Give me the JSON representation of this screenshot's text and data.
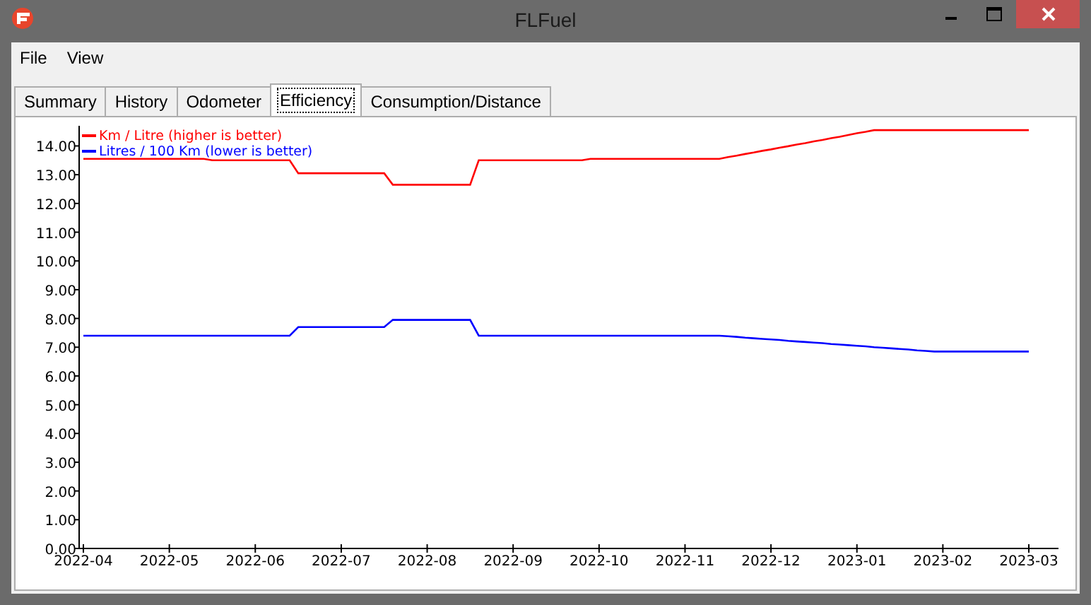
{
  "window": {
    "title": "FLFuel"
  },
  "menu": [
    {
      "label": "File"
    },
    {
      "label": "View"
    }
  ],
  "tabs": [
    {
      "label": "Summary",
      "selected": false
    },
    {
      "label": "History",
      "selected": false
    },
    {
      "label": "Odometer",
      "selected": false
    },
    {
      "label": "Efficiency",
      "selected": true
    },
    {
      "label": "Consumption/Distance",
      "selected": false
    }
  ],
  "chart": {
    "chart_data": {
      "type": "line",
      "categories": [
        "2022-04",
        null,
        null,
        null,
        null,
        null,
        null,
        null,
        null,
        null,
        "2022-05",
        null,
        null,
        null,
        null,
        null,
        null,
        null,
        null,
        null,
        "2022-06",
        null,
        null,
        null,
        null,
        null,
        null,
        null,
        null,
        null,
        "2022-07",
        null,
        null,
        null,
        null,
        null,
        null,
        null,
        null,
        null,
        "2022-08",
        null,
        null,
        null,
        null,
        null,
        null,
        null,
        null,
        null,
        "2022-09",
        null,
        null,
        null,
        null,
        null,
        null,
        null,
        null,
        null,
        "2022-10",
        null,
        null,
        null,
        null,
        null,
        null,
        null,
        null,
        null,
        "2022-11",
        null,
        null,
        null,
        null,
        null,
        null,
        null,
        null,
        null,
        "2022-12",
        null,
        null,
        null,
        null,
        null,
        null,
        null,
        null,
        null,
        "2023-01",
        null,
        null,
        null,
        null,
        null,
        null,
        null,
        null,
        null,
        "2023-02",
        null,
        null,
        null,
        null,
        null,
        null,
        null,
        null,
        null,
        "2023-03"
      ],
      "series": [
        {
          "name": "Km / Litre (higher is better)",
          "color": "#ff0000",
          "values": [
            13.55,
            13.55,
            13.55,
            13.55,
            13.55,
            13.55,
            13.55,
            13.55,
            13.55,
            13.55,
            13.55,
            13.55,
            13.55,
            13.55,
            13.55,
            13.5,
            13.5,
            13.5,
            13.5,
            13.5,
            13.5,
            13.5,
            13.5,
            13.5,
            13.5,
            13.05,
            13.05,
            13.05,
            13.05,
            13.05,
            13.05,
            13.05,
            13.05,
            13.05,
            13.05,
            13.05,
            12.65,
            12.65,
            12.65,
            12.65,
            12.65,
            12.65,
            12.65,
            12.65,
            12.65,
            12.65,
            13.5,
            13.5,
            13.5,
            13.5,
            13.5,
            13.5,
            13.5,
            13.5,
            13.5,
            13.5,
            13.5,
            13.5,
            13.5,
            13.55,
            13.55,
            13.55,
            13.55,
            13.55,
            13.55,
            13.55,
            13.55,
            13.55,
            13.55,
            13.55,
            13.55,
            13.55,
            13.55,
            13.55,
            13.55,
            13.61,
            13.66,
            13.72,
            13.77,
            13.83,
            13.88,
            13.94,
            13.99,
            14.05,
            14.1,
            14.16,
            14.21,
            14.27,
            14.32,
            14.38,
            14.44,
            14.49,
            14.55,
            14.55,
            14.55,
            14.55,
            14.55,
            14.55,
            14.55,
            14.55,
            14.55,
            14.55,
            14.55,
            14.55,
            14.55,
            14.55,
            14.55,
            14.55,
            14.55,
            14.55,
            14.55
          ]
        },
        {
          "name": "Litres / 100 Km (lower is better)",
          "color": "#0000ff",
          "values": [
            7.4,
            7.4,
            7.4,
            7.4,
            7.4,
            7.4,
            7.4,
            7.4,
            7.4,
            7.4,
            7.4,
            7.4,
            7.4,
            7.4,
            7.4,
            7.4,
            7.4,
            7.4,
            7.4,
            7.4,
            7.4,
            7.4,
            7.4,
            7.4,
            7.4,
            7.7,
            7.7,
            7.7,
            7.7,
            7.7,
            7.7,
            7.7,
            7.7,
            7.7,
            7.7,
            7.7,
            7.95,
            7.95,
            7.95,
            7.95,
            7.95,
            7.95,
            7.95,
            7.95,
            7.95,
            7.95,
            7.4,
            7.4,
            7.4,
            7.4,
            7.4,
            7.4,
            7.4,
            7.4,
            7.4,
            7.4,
            7.4,
            7.4,
            7.4,
            7.4,
            7.4,
            7.4,
            7.4,
            7.4,
            7.4,
            7.4,
            7.4,
            7.4,
            7.4,
            7.4,
            7.4,
            7.4,
            7.4,
            7.4,
            7.4,
            7.38,
            7.36,
            7.33,
            7.31,
            7.29,
            7.27,
            7.25,
            7.22,
            7.2,
            7.18,
            7.16,
            7.14,
            7.11,
            7.09,
            7.07,
            7.05,
            7.03,
            7.0,
            6.98,
            6.96,
            6.94,
            6.92,
            6.89,
            6.87,
            6.85,
            6.85,
            6.85,
            6.85,
            6.85,
            6.85,
            6.85,
            6.85,
            6.85,
            6.85,
            6.85,
            6.85
          ]
        }
      ],
      "ylim": [
        0,
        14.7
      ],
      "yticks": [
        {
          "value": 0,
          "label": "0.00"
        },
        {
          "value": 1,
          "label": "1.00"
        },
        {
          "value": 2,
          "label": "2.00"
        },
        {
          "value": 3,
          "label": "3.00"
        },
        {
          "value": 4,
          "label": "4.00"
        },
        {
          "value": 5,
          "label": "5.00"
        },
        {
          "value": 6,
          "label": "6.00"
        },
        {
          "value": 7,
          "label": "7.00"
        },
        {
          "value": 8,
          "label": "8.00"
        },
        {
          "value": 9,
          "label": "9.00"
        },
        {
          "value": 10,
          "label": "10.00"
        },
        {
          "value": 11,
          "label": "11.00"
        },
        {
          "value": 12,
          "label": "12.00"
        },
        {
          "value": 13,
          "label": "13.00"
        },
        {
          "value": 14,
          "label": "14.00"
        }
      ]
    }
  }
}
